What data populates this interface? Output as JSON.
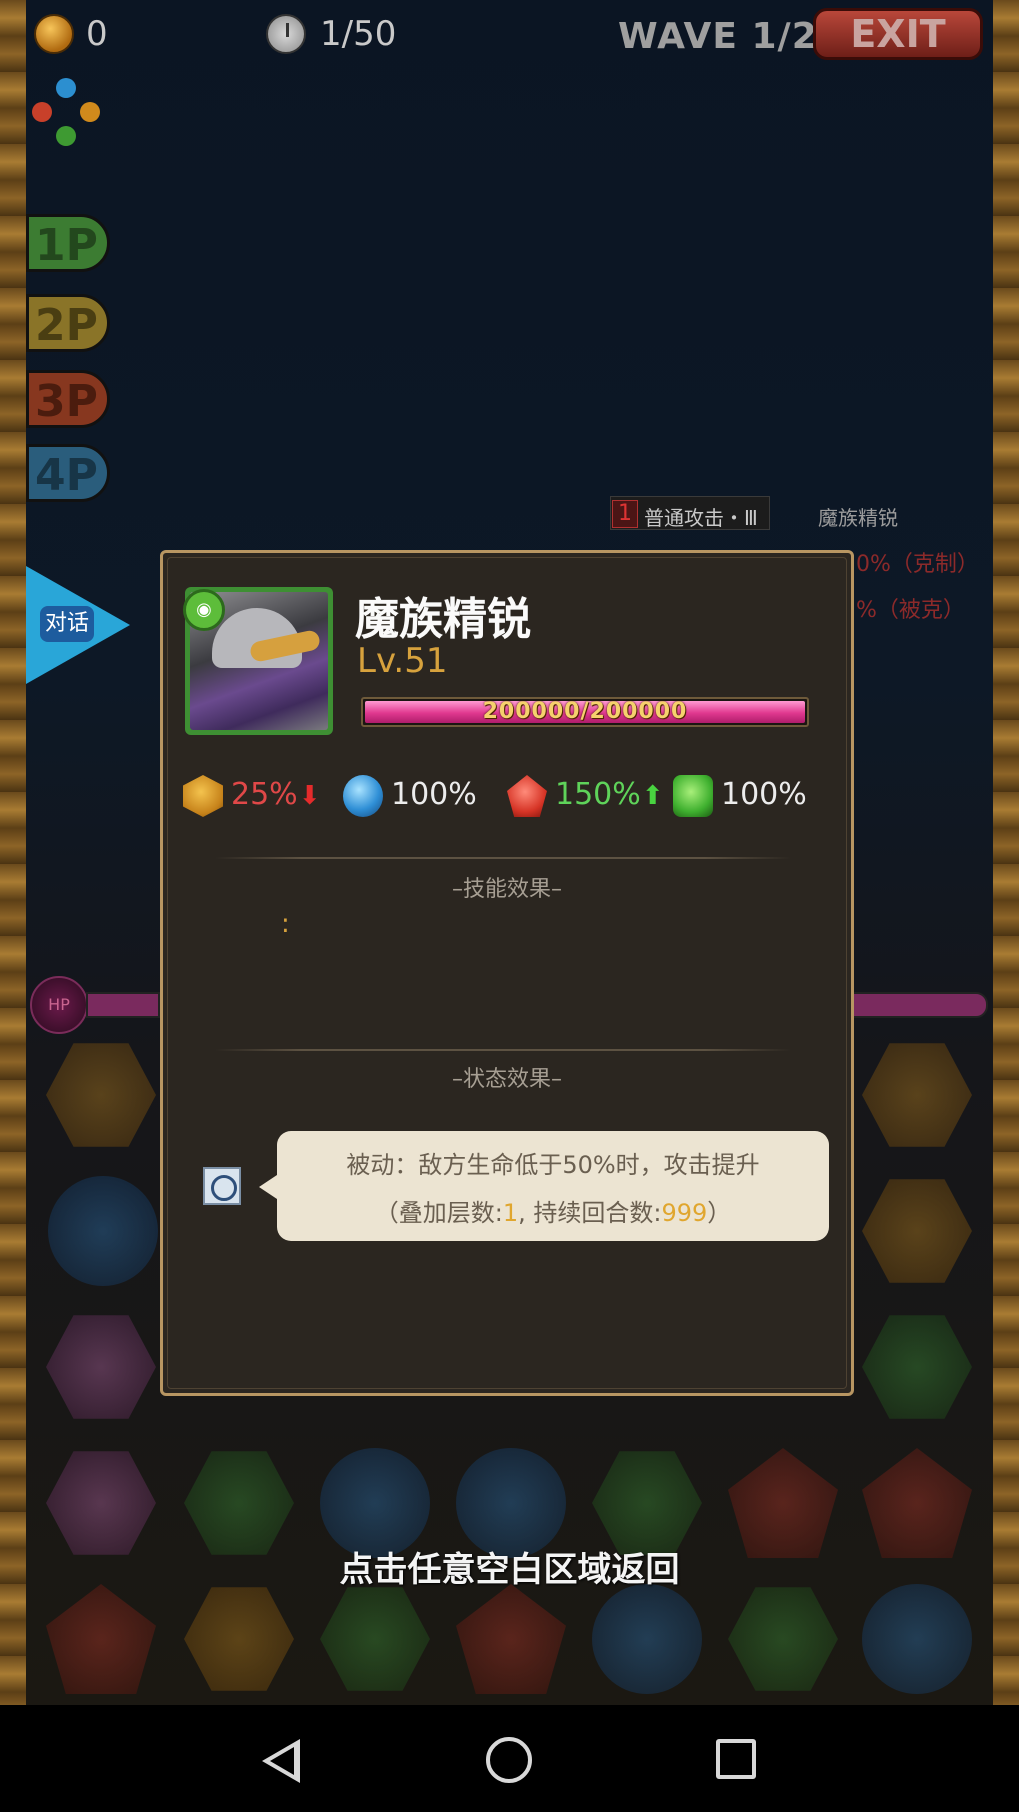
{
  "hud": {
    "coins": "0",
    "turns": "1/50",
    "wave": "WAVE 1/2",
    "exit_label": "EXIT"
  },
  "party_tabs": [
    "1P",
    "2P",
    "3P",
    "4P"
  ],
  "talk_button": {
    "label": "对话"
  },
  "background_panel": {
    "skill_number": "1",
    "skill_name": "普通攻击・Ⅲ",
    "enemy_name": "魔族精锐",
    "line1": "0%（克制）",
    "line2": "%（被克）"
  },
  "hp_label": "HP",
  "enemy": {
    "name": "魔族精锐",
    "level": "Lv.51",
    "hp_text": "200000/200000",
    "hp_fraction": 1.0
  },
  "resistances": [
    {
      "icon": "gold-element-icon",
      "value": "25%",
      "trend": "down",
      "color": "#e04848"
    },
    {
      "icon": "water-element-icon",
      "value": "100%",
      "trend": "none",
      "color": "#ececec"
    },
    {
      "icon": "fire-element-icon",
      "value": "150%",
      "trend": "up",
      "color": "#5fd35a"
    },
    {
      "icon": "wood-element-icon",
      "value": "100%",
      "trend": "none",
      "color": "#ececec"
    }
  ],
  "skill_section": {
    "title": "–技能效果–",
    "content": ":"
  },
  "status_section": {
    "title": "–状态效果–",
    "effect": {
      "icon": "buff-target-icon",
      "line1": "被动：敌方生命低于50%时，攻击提升",
      "line2_prefix": "（叠加层数:",
      "stacks": "1",
      "line2_middle": ", 持续回合数:",
      "duration": "999",
      "line2_suffix": "）"
    }
  },
  "hint": "点击任意空白区域返回",
  "colors": {
    "modal_border": "#b89662",
    "level_gold": "#d7a23d",
    "hp_pink": "#e0388f"
  }
}
